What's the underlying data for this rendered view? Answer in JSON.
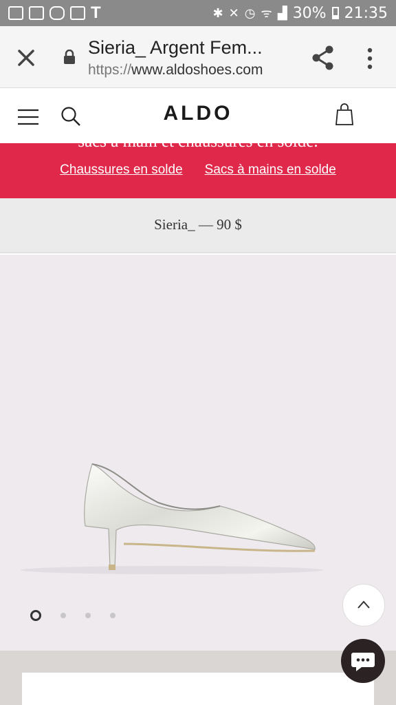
{
  "status_bar": {
    "battery": "30%",
    "time": "21:35"
  },
  "browser": {
    "tab_title": "Sieria_ Argent Fem...",
    "url_scheme": "https://",
    "url_host": "www.aldoshoes.com"
  },
  "site_header": {
    "logo": "ALDO"
  },
  "promo": {
    "cut_text": "sacs à main et chaussures en solde.",
    "links": [
      "Chaussures en solde",
      "Sacs à mains en solde"
    ]
  },
  "product": {
    "title_price": "Sieria_ — 90 $"
  },
  "gallery": {
    "image_count": 4,
    "active_index": 0
  },
  "colors": {
    "promo_red": "#e0284a",
    "status_gray": "#8a8a8a",
    "gallery_bg": "#eeeaee"
  }
}
